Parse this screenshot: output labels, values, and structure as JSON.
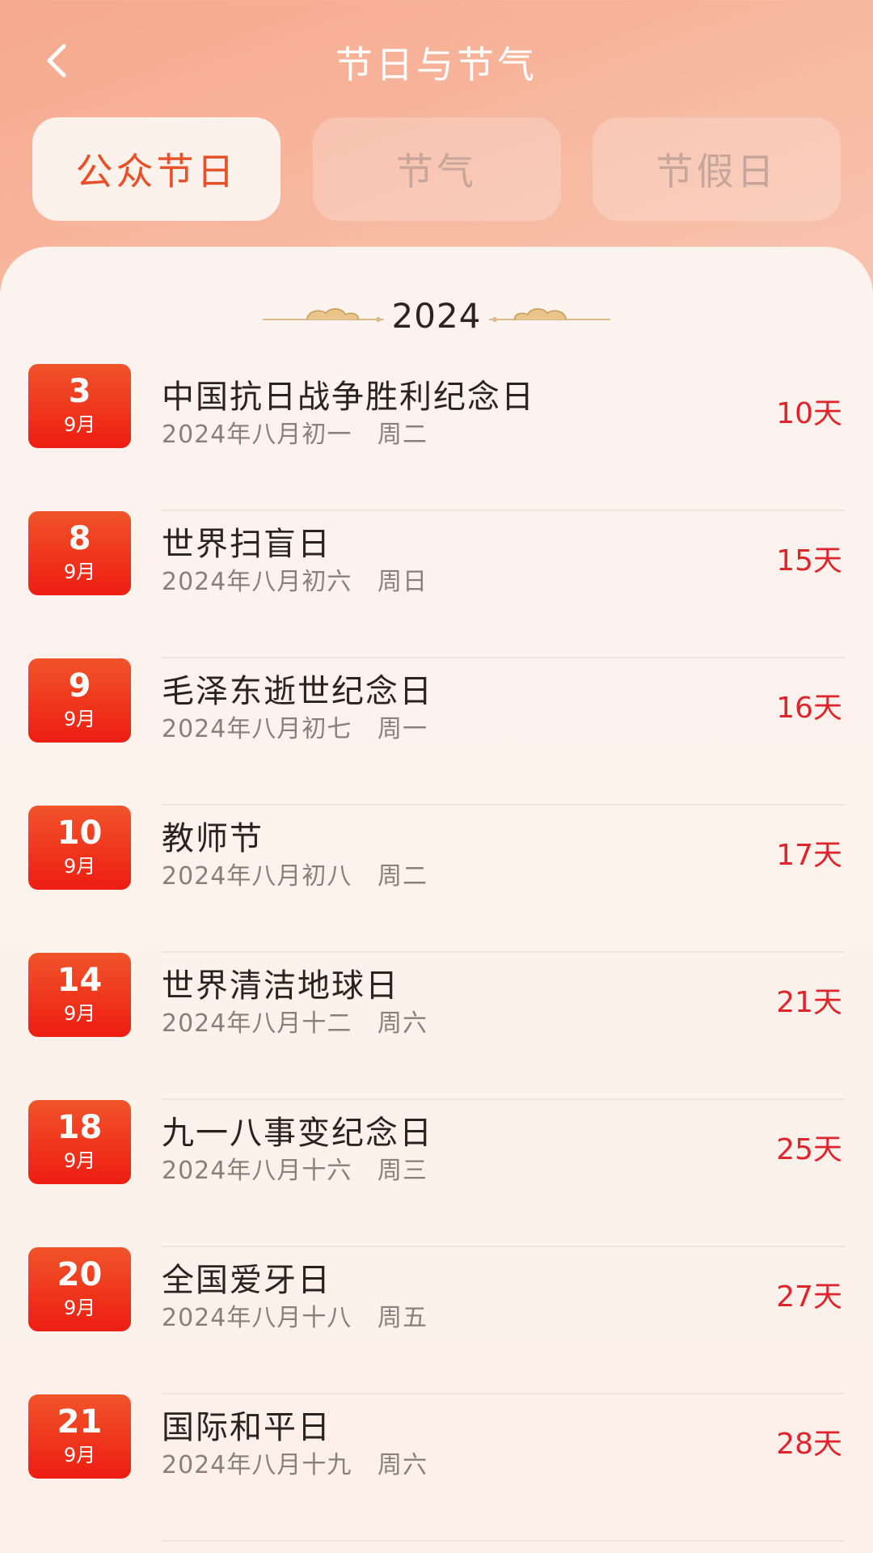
{
  "header": {
    "title": "节日与节气",
    "back_icon": "chevron-left-icon"
  },
  "tabs": [
    {
      "label": "公众节日",
      "active": true
    },
    {
      "label": "节气",
      "active": false
    },
    {
      "label": "节假日",
      "active": false
    }
  ],
  "year": "2024",
  "colors": {
    "accent": "#e8502a",
    "badge": "#ee1d12",
    "countdown": "#e0242b"
  },
  "events": [
    {
      "day": "3",
      "month": "9月",
      "name": "中国抗日战争胜利纪念日",
      "lunar": "2024年八月初一",
      "weekday": "周二",
      "countdown": "10天"
    },
    {
      "day": "8",
      "month": "9月",
      "name": "世界扫盲日",
      "lunar": "2024年八月初六",
      "weekday": "周日",
      "countdown": "15天"
    },
    {
      "day": "9",
      "month": "9月",
      "name": "毛泽东逝世纪念日",
      "lunar": "2024年八月初七",
      "weekday": "周一",
      "countdown": "16天"
    },
    {
      "day": "10",
      "month": "9月",
      "name": "教师节",
      "lunar": "2024年八月初八",
      "weekday": "周二",
      "countdown": "17天"
    },
    {
      "day": "14",
      "month": "9月",
      "name": "世界清洁地球日",
      "lunar": "2024年八月十二",
      "weekday": "周六",
      "countdown": "21天"
    },
    {
      "day": "18",
      "month": "9月",
      "name": "九一八事变纪念日",
      "lunar": "2024年八月十六",
      "weekday": "周三",
      "countdown": "25天"
    },
    {
      "day": "20",
      "month": "9月",
      "name": "全国爱牙日",
      "lunar": "2024年八月十八",
      "weekday": "周五",
      "countdown": "27天"
    },
    {
      "day": "21",
      "month": "9月",
      "name": "国际和平日",
      "lunar": "2024年八月十九",
      "weekday": "周六",
      "countdown": "28天"
    }
  ]
}
